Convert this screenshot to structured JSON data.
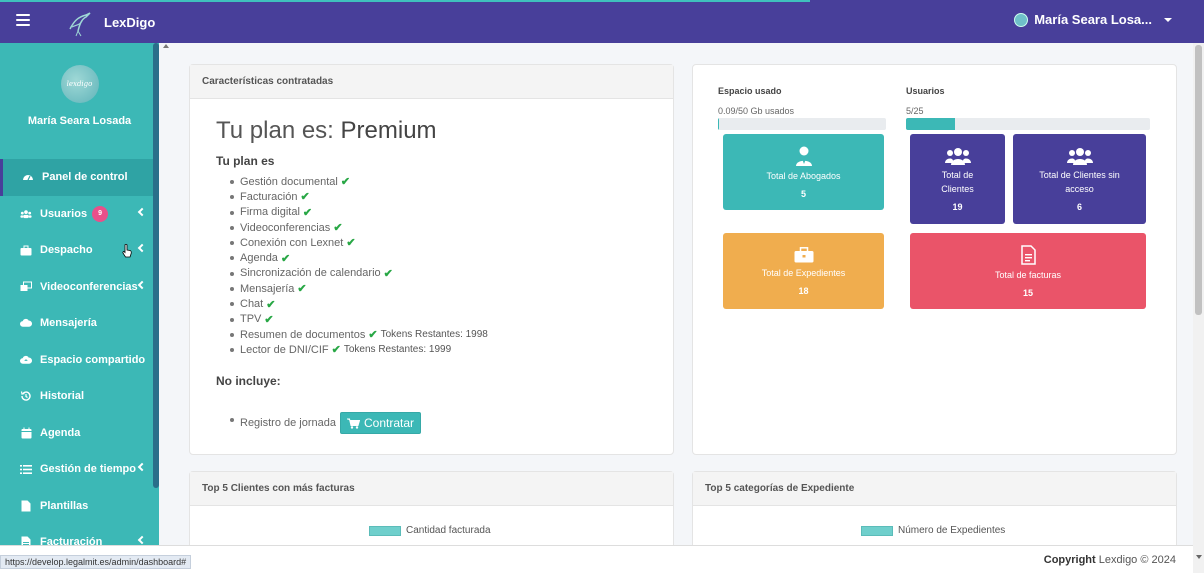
{
  "navbar": {
    "brand": "LexDigo",
    "user_name": "María Seara Losa..."
  },
  "sidebar": {
    "profile_name": "María Seara Losada",
    "avatar_text": "lexdigo",
    "items": [
      {
        "label": "Panel de control",
        "icon": "dashboard-icon"
      },
      {
        "label": "Usuarios",
        "icon": "users-icon",
        "badge": "9"
      },
      {
        "label": "Despacho",
        "icon": "briefcase-icon"
      },
      {
        "label": "Videoconferencias",
        "icon": "video-icon"
      },
      {
        "label": "Mensajería",
        "icon": "cloud-icon"
      },
      {
        "label": "Espacio compartido",
        "icon": "cloud-upload-icon"
      },
      {
        "label": "Historial",
        "icon": "history-icon"
      },
      {
        "label": "Agenda",
        "icon": "calendar-icon"
      },
      {
        "label": "Gestión de tiempo",
        "icon": "list-icon"
      },
      {
        "label": "Plantillas",
        "icon": "file-icon"
      },
      {
        "label": "Facturación",
        "icon": "invoice-icon"
      }
    ]
  },
  "plan": {
    "header": "Características contratadas",
    "title_prefix": "Tu plan es:",
    "title_plan": "Premium",
    "subtitle": "Tu plan es",
    "features": [
      "Gestión documental",
      "Facturación",
      "Firma digital",
      "Videoconferencias",
      "Conexión con Lexnet",
      "Agenda",
      "Sincronización de calendario",
      "Mensajería",
      "Chat",
      "TPV",
      "Resumen de documentos",
      "Lector de DNI/CIF"
    ],
    "tokens_resumen": "Tokens Restantes: 1998",
    "tokens_dni": "Tokens Restantes: 1999",
    "not_included_title": "No incluye:",
    "not_included_item": "Registro de jornada",
    "contratar_label": "Contratar"
  },
  "stats": {
    "space_label": "Espacio usado",
    "space_value": "0.09/50 Gb usados",
    "space_fraction": 0.0018,
    "users_label": "Usuarios",
    "users_value": "5/25",
    "users_fraction": 0.2,
    "tiles": {
      "abogados": {
        "label": "Total de Abogados",
        "value": "5",
        "color": "#3cb8b6"
      },
      "clientes": {
        "label1": "Total de",
        "label2": "Clientes",
        "value": "19",
        "color": "#483f9a"
      },
      "sin_acceso": {
        "label1": "Total de Clientes sin",
        "label2": "acceso",
        "value": "6",
        "color": "#483f9a"
      },
      "expedientes": {
        "label": "Total de Expedientes",
        "value": "18",
        "color": "#f0ad4e"
      },
      "facturas": {
        "label": "Total de facturas",
        "value": "15",
        "color": "#ea5469"
      }
    }
  },
  "charts": {
    "clientes_header": "Top 5 Clientes con más facturas",
    "clientes_legend": "Cantidad facturada",
    "categorias_header": "Top 5 categorías de Expediente",
    "categorias_legend": "Número de Expedientes"
  },
  "footer": {
    "copyright_label": "Copyright",
    "copyright_text": "Lexdigo © 2024",
    "status_url": "https://develop.legalmit.es/admin/dashboard#"
  }
}
